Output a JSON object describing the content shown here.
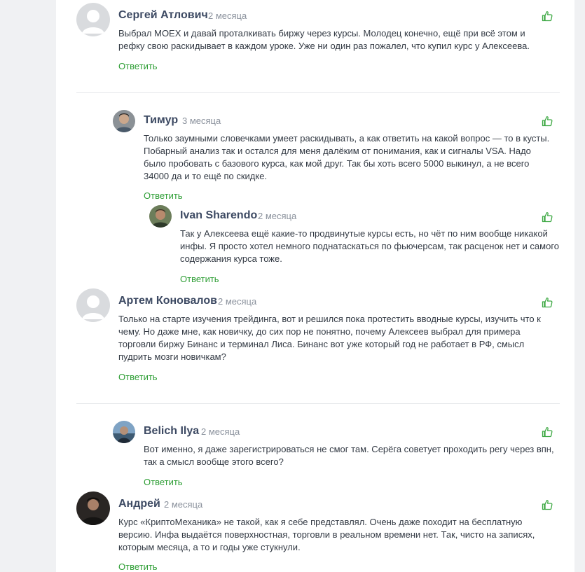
{
  "colors": {
    "author": "#3d4a63",
    "date": "#8a919c",
    "text": "#333a44",
    "reply": "#2e9e35",
    "like": "#3fa945",
    "divider": "#e6e8eb",
    "page_bg": "#f0f1f3"
  },
  "icons": {
    "like": "thumbs-up-icon",
    "default_avatar": "user-silhouette-icon"
  },
  "comments": [
    {
      "author": "Сергей Атлович",
      "date": "2 месяца",
      "text": "Выбрал MOEX и давай проталкивать биржу через курсы. Молодец конечно, ещё при всё этом и рефку свою раскидывает в каждом уроке. Уже ни один раз пожалел, что купил курс у Алексеева.",
      "reply_label": "Ответить"
    },
    {
      "author": "Тимур",
      "date": "3 месяца",
      "text": "Только заумными словечками умеет раскидывать, а как ответить на какой вопрос — то в кусты. Побарный анализ так и остался для меня далёким от понимания, как и сигналы VSA. Надо было пробовать с базового курса, как мой друг. Так бы хоть всего 5000 выкинул, а не всего 34000 да и то ещё по скидке.",
      "reply_label": "Ответить"
    },
    {
      "author": "Ivan Sharendo",
      "date": "2 месяца",
      "text": "Так у Алексеева ещё какие-то продвинутые курсы есть, но чёт по ним вообще никакой инфы. Я просто хотел немного поднатаскаться по фьючерсам, так расценок нет и самого содержания курса тоже.",
      "reply_label": "Ответить"
    },
    {
      "author": "Артем Коновалов",
      "date": "2 месяца",
      "text": "Только на старте изучения трейдинга, вот и решился пока протестить вводные курсы, изучить что к чему. Но даже мне, как новичку, до сих пор не понятно, почему Алексеев выбрал для примера торговли биржу Бинанс и терминал Лиса. Бинанс вот уже который год не работает в РФ, смысл пудрить мозги новичкам?",
      "reply_label": "Ответить"
    },
    {
      "author": "Belich Ilya",
      "date": "2 месяца",
      "text": "Вот именно, я даже зарегистрироваться не смог там. Серёга советует проходить регу через впн, так а смысл вообще этого всего?",
      "reply_label": "Ответить"
    },
    {
      "author": "Андрей",
      "date": "2 месяца",
      "text": "Курс «КриптоМеханика» не такой, как я себе представлял. Очень даже походит на бесплатную версию. Инфа выдаётся поверхностная, торговли в реальном времени нет. Так, чисто на записях, которым месяца, а то и годы уже стукнули.",
      "reply_label": "Ответить"
    }
  ]
}
